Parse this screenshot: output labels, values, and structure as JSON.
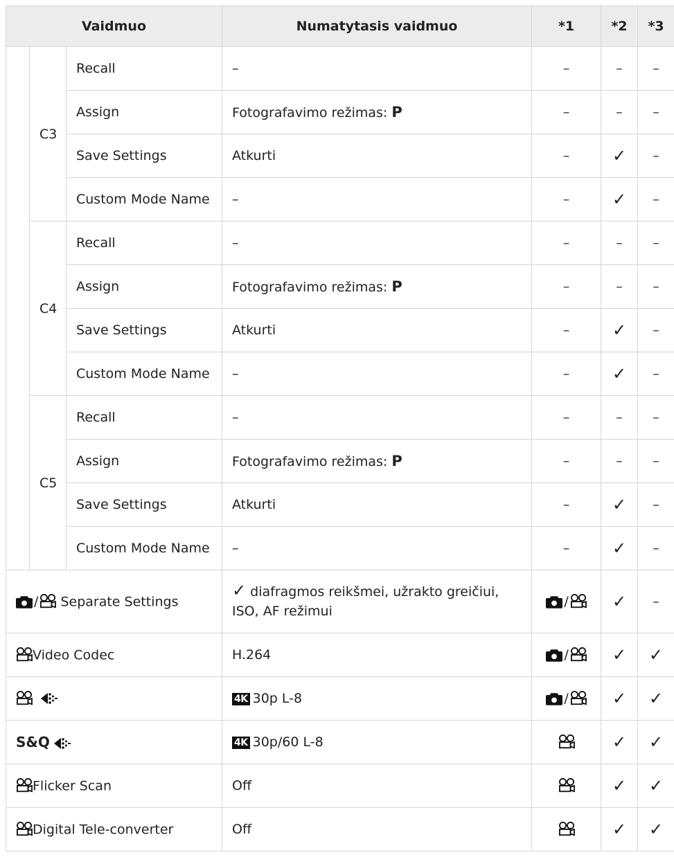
{
  "header": {
    "mode": "Vaidmuo",
    "default": "Numatytasis vaidmuo",
    "c1": "*1",
    "c2": "*2",
    "c3": "*3"
  },
  "groups": [
    {
      "name": "C3",
      "rows": [
        {
          "label": "Recall",
          "value": "–",
          "c1": "–",
          "c2": "–",
          "c3": "–"
        },
        {
          "label": "Assign",
          "value": "Fotografavimo režimas:",
          "value_bold": "P",
          "c1": "–",
          "c2": "–",
          "c3": "–"
        },
        {
          "label": "Save Settings",
          "value": "Atkurti",
          "c1": "–",
          "c2": "✓",
          "c3": "–"
        },
        {
          "label": "Custom Mode Name",
          "value": "–",
          "c1": "–",
          "c2": "✓",
          "c3": "–"
        }
      ]
    },
    {
      "name": "C4",
      "rows": [
        {
          "label": "Recall",
          "value": "–",
          "c1": "–",
          "c2": "–",
          "c3": "–"
        },
        {
          "label": "Assign",
          "value": "Fotografavimo režimas:",
          "value_bold": "P",
          "c1": "–",
          "c2": "–",
          "c3": "–"
        },
        {
          "label": "Save Settings",
          "value": "Atkurti",
          "c1": "–",
          "c2": "✓",
          "c3": "–"
        },
        {
          "label": "Custom Mode Name",
          "value": "–",
          "c1": "–",
          "c2": "✓",
          "c3": "–"
        }
      ]
    },
    {
      "name": "C5",
      "rows": [
        {
          "label": "Recall",
          "value": "–",
          "c1": "–",
          "c2": "–",
          "c3": "–"
        },
        {
          "label": "Assign",
          "value": "Fotografavimo režimas:",
          "value_bold": "P",
          "c1": "–",
          "c2": "–",
          "c3": "–"
        },
        {
          "label": "Save Settings",
          "value": "Atkurti",
          "c1": "–",
          "c2": "✓",
          "c3": "–"
        },
        {
          "label": "Custom Mode Name",
          "value": "–",
          "c1": "–",
          "c2": "✓",
          "c3": "–"
        }
      ]
    }
  ],
  "rows": {
    "separate": {
      "label": "Separate Settings",
      "check": "✓",
      "value": "diafragmos reikšmei, užrakto greičiui,",
      "value2": "ISO, AF režimui",
      "c1_sep": "/",
      "c2": "✓",
      "c3": "–"
    },
    "codec": {
      "label": "Video Codec",
      "value": "H.264",
      "c1_sep": "/",
      "c2": "✓",
      "c3": "✓"
    },
    "quality": {
      "value": "30p L-8",
      "badge": "4K",
      "c1_sep": "/",
      "c2": "✓",
      "c3": "✓"
    },
    "sq": {
      "prefix": "S&Q",
      "value": "30p/60 L-8",
      "badge": "4K",
      "c2": "✓",
      "c3": "✓"
    },
    "flicker": {
      "label": "Flicker Scan",
      "value": "Off",
      "c2": "✓",
      "c3": "✓"
    },
    "tele": {
      "label": "Digital Tele-converter",
      "value": "Off",
      "c2": "✓",
      "c3": "✓"
    }
  },
  "icons": [
    "camera-icon",
    "movie-icon",
    "image-quality-icon",
    "check-icon"
  ]
}
